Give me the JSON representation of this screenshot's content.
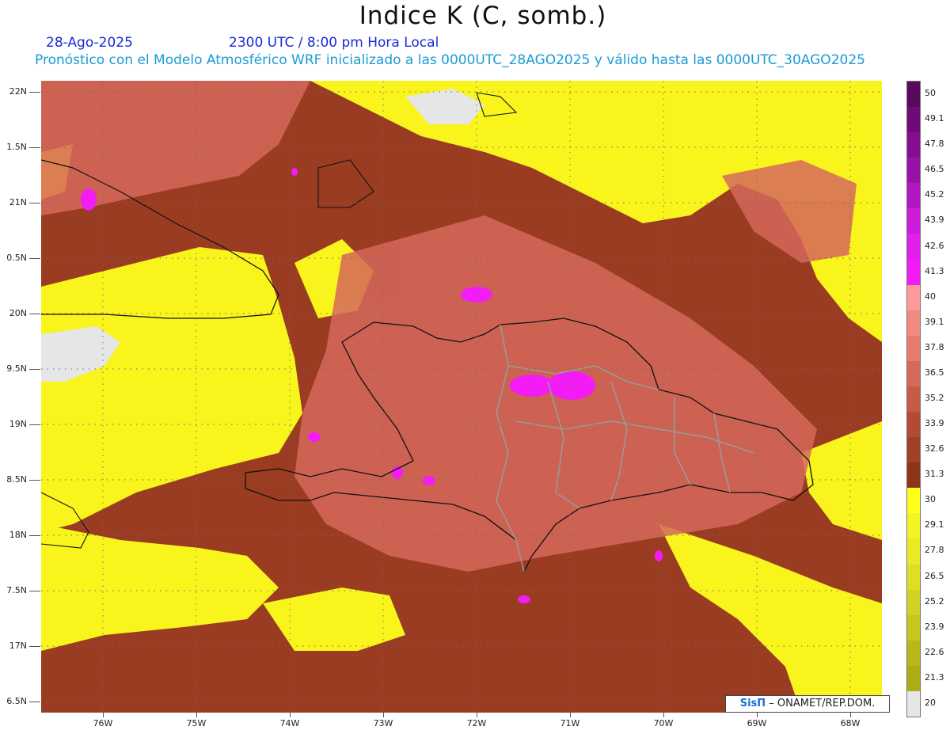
{
  "header": {
    "title": "Indice K (C, somb.)",
    "date": "28-Ago-2025",
    "time": "2300 UTC / 8:00 pm Hora Local",
    "description": "Pronóstico con el Modelo Atmosférico WRF inicializado a las 0000UTC_28AGO2025 y válido hasta las  0000UTC_30AGO2025"
  },
  "map": {
    "latitude_labels": [
      "22N",
      "1.5N",
      "21N",
      "0.5N",
      "20N",
      "9.5N",
      "19N",
      "8.5N",
      "18N",
      "7.5N",
      "17N",
      "6.5N"
    ],
    "longitude_labels": [
      "76W",
      "75W",
      "74W",
      "73W",
      "72W",
      "71W",
      "70W",
      "69W",
      "68W"
    ],
    "gridlines": true
  },
  "colorbar": {
    "labels": [
      "50",
      "49.1",
      "47.8",
      "46.5",
      "45.2",
      "43.9",
      "42.6",
      "41.3",
      "40",
      "39.1",
      "37.8",
      "36.5",
      "35.2",
      "33.9",
      "32.6",
      "31.3",
      "30",
      "29.1",
      "27.8",
      "26.5",
      "25.2",
      "23.9",
      "22.6",
      "21.3",
      "20"
    ],
    "colors": [
      "#5a0a5e",
      "#6f0a78",
      "#860c92",
      "#9c10aa",
      "#b416c4",
      "#cc1cda",
      "#e21eec",
      "#f41cf6",
      "#ff9a9a",
      "#f28a80",
      "#e67a6e",
      "#d8685a",
      "#c85a48",
      "#b34a36",
      "#a23f28",
      "#8e3418",
      "#ffff1c",
      "#f4f424",
      "#eaea24",
      "#dede24",
      "#d2d224",
      "#c6c620",
      "#b8b818",
      "#acac14",
      "#e6e6e6"
    ]
  },
  "credit": {
    "brand": "SisΠ",
    "text": " – ONAMET/REP.DOM."
  }
}
